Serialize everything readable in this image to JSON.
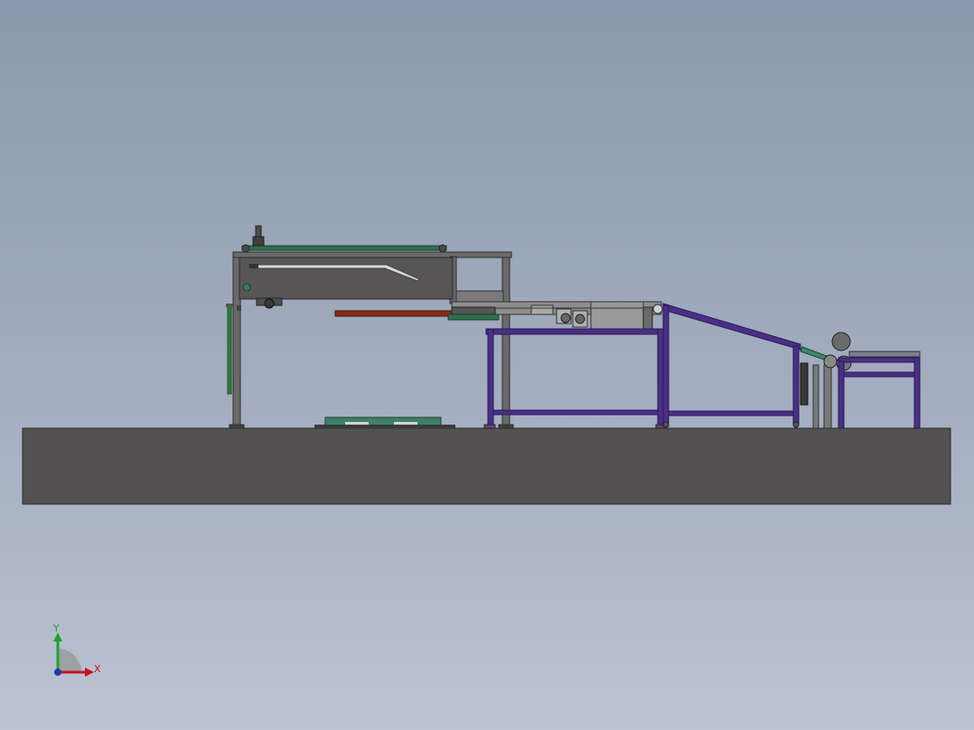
{
  "colors": {
    "frame_grey": "#5e5e5e",
    "frame_purple": "#4a2f86",
    "floor": "#535151",
    "belt_green": "#2f6f4f",
    "pallet_teal": "#3f7f6a",
    "red_bar": "#8a2a1c",
    "axis_x": "#c0141e",
    "axis_y": "#22a032",
    "axis_z": "#1e3ca0"
  },
  "triad": {
    "x_label": "X",
    "y_label": "Y"
  }
}
